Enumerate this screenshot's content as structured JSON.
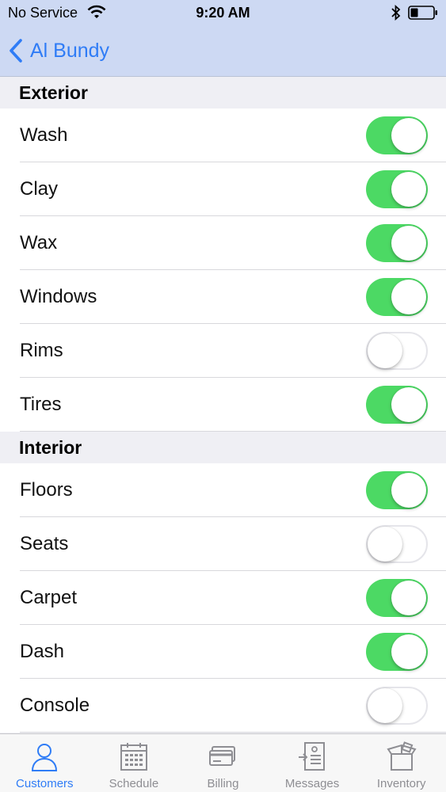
{
  "status": {
    "carrier": "No Service",
    "time": "9:20 AM"
  },
  "nav": {
    "back_label": "Al Bundy"
  },
  "sections": [
    {
      "title": "Exterior",
      "items": [
        {
          "label": "Wash",
          "on": true
        },
        {
          "label": "Clay",
          "on": true
        },
        {
          "label": "Wax",
          "on": true
        },
        {
          "label": "Windows",
          "on": true
        },
        {
          "label": "Rims",
          "on": false
        },
        {
          "label": "Tires",
          "on": true
        }
      ]
    },
    {
      "title": "Interior",
      "items": [
        {
          "label": "Floors",
          "on": true
        },
        {
          "label": "Seats",
          "on": false
        },
        {
          "label": "Carpet",
          "on": true
        },
        {
          "label": "Dash",
          "on": true
        },
        {
          "label": "Console",
          "on": false
        }
      ]
    }
  ],
  "tabs": [
    {
      "label": "Customers",
      "icon": "person-icon",
      "active": true
    },
    {
      "label": "Schedule",
      "icon": "calendar-icon",
      "active": false
    },
    {
      "label": "Billing",
      "icon": "credit-card-icon",
      "active": false
    },
    {
      "label": "Messages",
      "icon": "contact-card-icon",
      "active": false
    },
    {
      "label": "Inventory",
      "icon": "box-icon",
      "active": false
    }
  ],
  "colors": {
    "accent": "#2f7cf6",
    "toggle_on": "#4cd964",
    "nav_background": "#cdd9f3",
    "inactive_tab": "#8e8e93"
  }
}
